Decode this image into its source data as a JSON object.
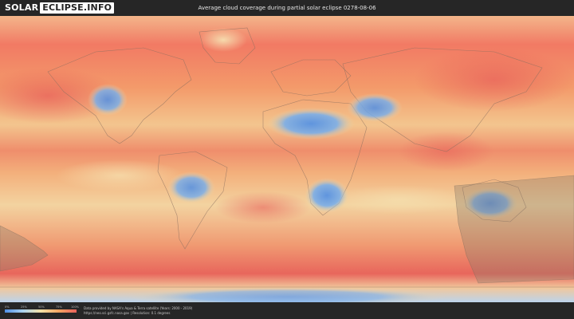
{
  "header": {
    "logo_part1": "SOLAR",
    "logo_part2": "ECLIPSE.INFO",
    "title": "Average cloud coverage during partial solar eclipse 0278-08-06"
  },
  "map": {
    "colors": {
      "ocean_low": "#f3e1a6",
      "mid": "#f3a562",
      "high": "#e8605a",
      "clear": "#4f8fe6",
      "eclipse_shadow": "#8a7a6a",
      "coast": "#8a6f60"
    }
  },
  "legend": {
    "ticks": [
      "0%",
      "25%",
      "50%",
      "75%",
      "100%"
    ],
    "colors": [
      "#4f8fe6",
      "#a9d2ef",
      "#f3e1a6",
      "#f3a562",
      "#e8605a"
    ]
  },
  "footer": {
    "credit_line1": "Data provided by NASA's Aqua & Terra satellite (Years: 2000 - 2019)",
    "credit_line2": "https://neo.sci.gsfc.nasa.gov | Resolution: 0.1 degrees"
  }
}
